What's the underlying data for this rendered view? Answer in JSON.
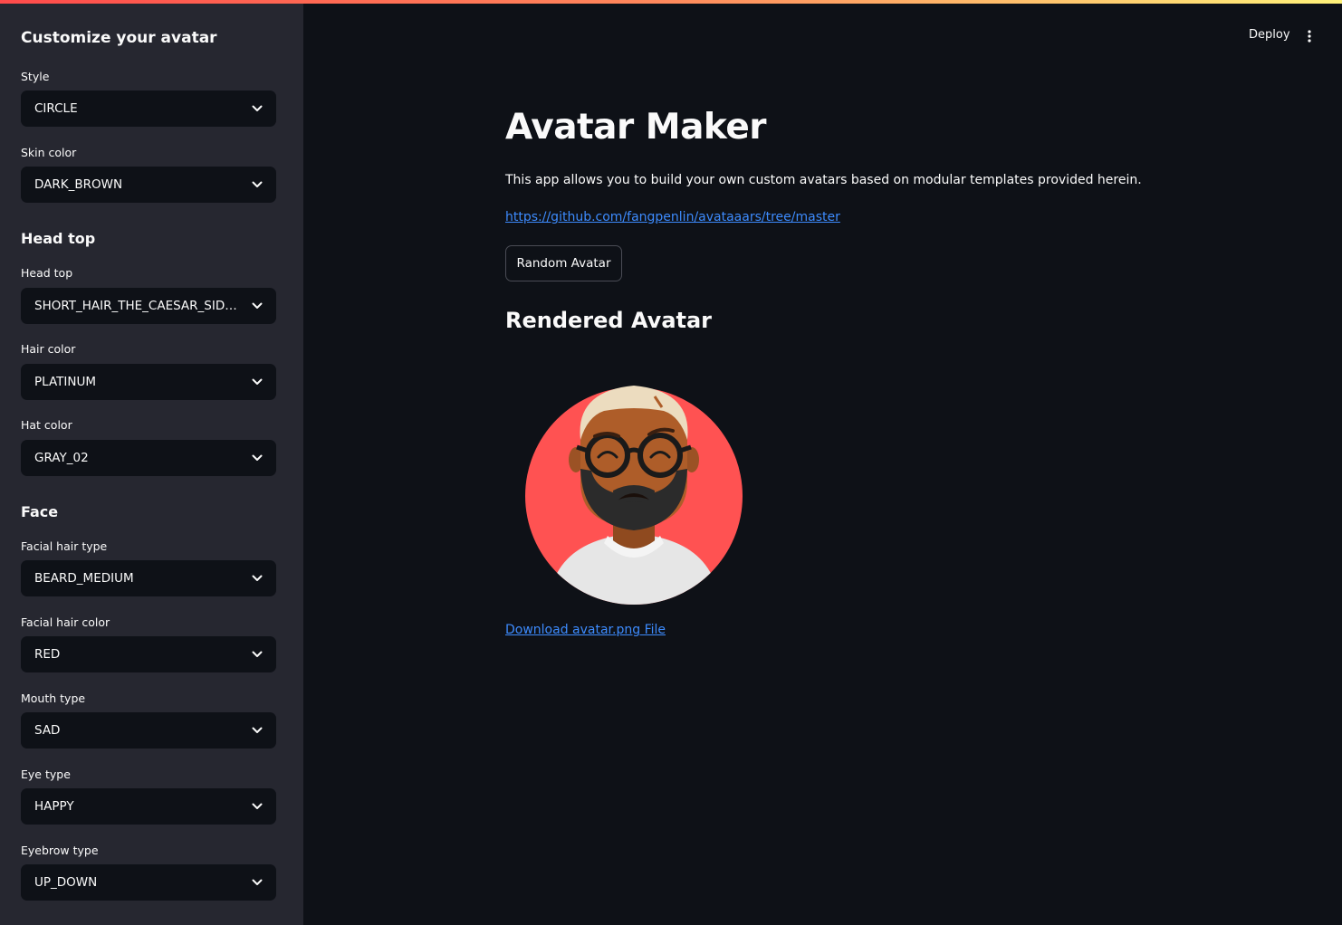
{
  "sidebar": {
    "title": "Customize your avatar",
    "style": {
      "label": "Style",
      "value": "CIRCLE"
    },
    "skin_color": {
      "label": "Skin color",
      "value": "DARK_BROWN"
    },
    "head_top_section": "Head top",
    "head_top": {
      "label": "Head top",
      "value": "SHORT_HAIR_THE_CAESAR_SIDE_PART"
    },
    "hair_color": {
      "label": "Hair color",
      "value": "PLATINUM"
    },
    "hat_color": {
      "label": "Hat color",
      "value": "GRAY_02"
    },
    "face_section": "Face",
    "facial_hair_type": {
      "label": "Facial hair type",
      "value": "BEARD_MEDIUM"
    },
    "facial_hair_color": {
      "label": "Facial hair color",
      "value": "RED"
    },
    "mouth_type": {
      "label": "Mouth type",
      "value": "SAD"
    },
    "eye_type": {
      "label": "Eye type",
      "value": "HAPPY"
    },
    "eyebrow_type": {
      "label": "Eyebrow type",
      "value": "UP_DOWN"
    }
  },
  "header": {
    "deploy_label": "Deploy",
    "menu_icon": "more-vertical-icon"
  },
  "main": {
    "title": "Avatar Maker",
    "description": "This app allows you to build your own custom avatars based on modular templates provided herein.",
    "repo_link": "https://github.com/fangpenlin/avataaars/tree/master",
    "random_button": "Random Avatar",
    "rendered_heading": "Rendered Avatar",
    "download_link": "Download avatar.png File"
  },
  "colors": {
    "app_background": "#0e1117",
    "sidebar_background": "#262730",
    "select_background": "#0e1117",
    "link": "#3d8bfd",
    "avatar_background": "#ff5252",
    "skin": "#ae5d29",
    "hair": "#ecdcbf",
    "beard": "#2b2b2b",
    "shirt": "#e6e6e6"
  }
}
